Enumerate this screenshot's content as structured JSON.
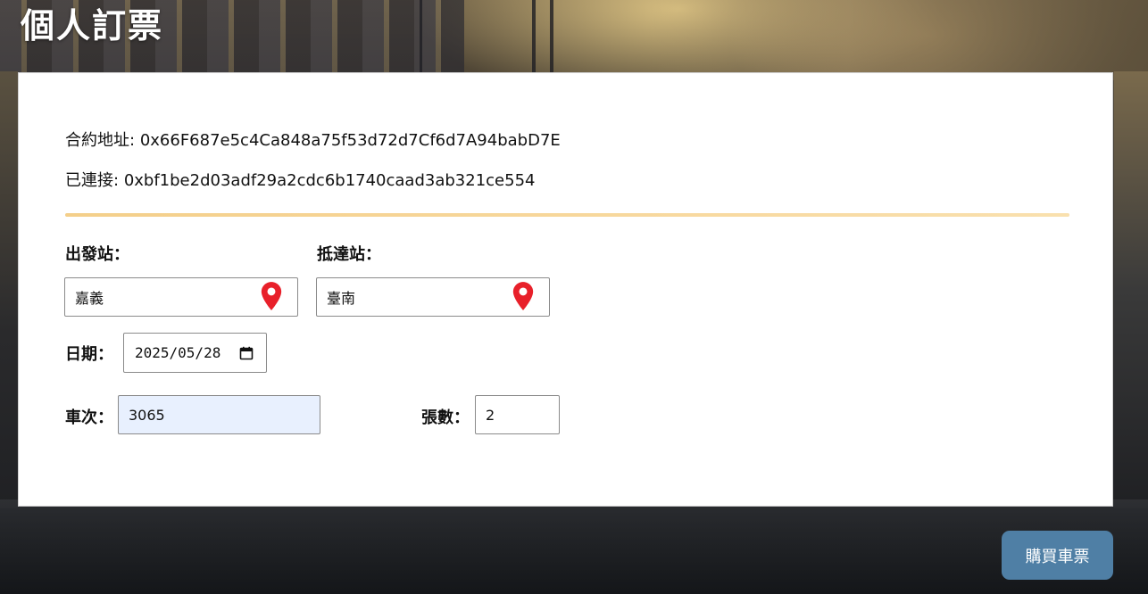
{
  "header": {
    "title": "個人訂票"
  },
  "contract": {
    "label": "合約地址:",
    "address": "0x66F687e5c4Ca848a75f53d72d7Cf6d7A94babD7E"
  },
  "connection": {
    "label": "已連接:",
    "address": "0xbf1be2d03adf29a2cdc6b1740caad3ab321ce554"
  },
  "form": {
    "departure_label": "出發站：",
    "departure_value": "嘉義",
    "departure_icon": "map-pin-icon",
    "arrival_label": "抵達站：",
    "arrival_value": "臺南",
    "arrival_icon": "map-pin-icon",
    "date_label": "日期：",
    "date_value": "2025/05/28",
    "date_icon": "calendar-icon",
    "train_label": "車次：",
    "train_value": "3065",
    "quantity_label": "張數：",
    "quantity_value": "2"
  },
  "actions": {
    "buy_label": "購買車票"
  },
  "colors": {
    "pin": "#e8202a",
    "divider": "#f4cf8a",
    "train_field_bg": "#e8f0fe",
    "buy_button": "#4f7fa5"
  }
}
